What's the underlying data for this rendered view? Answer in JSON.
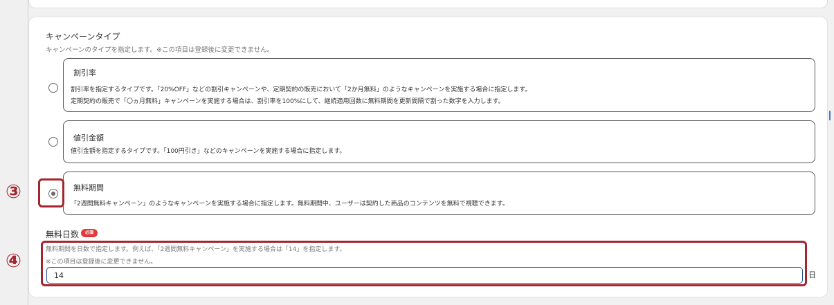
{
  "section": {
    "title": "キャンペーンタイプ",
    "description": "キャンペーンのタイプを指定します。※この項目は登録後に変更できません。"
  },
  "options": [
    {
      "title": "割引率",
      "lines": [
        "割引率を指定するタイプです。「20%OFF」などの割引キャンペーンや、定期契約の販売において「2か月無料」のようなキャンペーンを実施する場合に指定します。",
        "定期契約の販売で「〇ヵ月無料」キャンペーンを実施する場合は、割引率を100%にして、継続適用回数に無料期間を更新間隔で割った数字を入力します。"
      ],
      "selected": false
    },
    {
      "title": "値引金額",
      "lines": [
        "値引金額を指定するタイプです。「100円引き」などのキャンペーンを実施する場合に指定します。"
      ],
      "selected": false
    },
    {
      "title": "無料期間",
      "lines": [
        "「2週間無料キャンペーン」のようなキャンペーンを実施する場合に指定します。無料期間中、ユーザーは契約した商品のコンテンツを無料で視聴できます。"
      ],
      "selected": true
    }
  ],
  "free_days": {
    "label": "無料日数",
    "required_badge": "必須",
    "description": "無料期間を日数で指定します。例えば、「2週間無料キャンペーン」を実施する場合は「14」を指定します。",
    "note": "※この項目は登録後に変更できません。",
    "value": "14",
    "unit": "日"
  },
  "callouts": {
    "radio": "③",
    "field": "④"
  },
  "colors": {
    "callout": "#a3262e",
    "required_badge": "#e03a3a",
    "input_border": "#2a4f8a"
  }
}
